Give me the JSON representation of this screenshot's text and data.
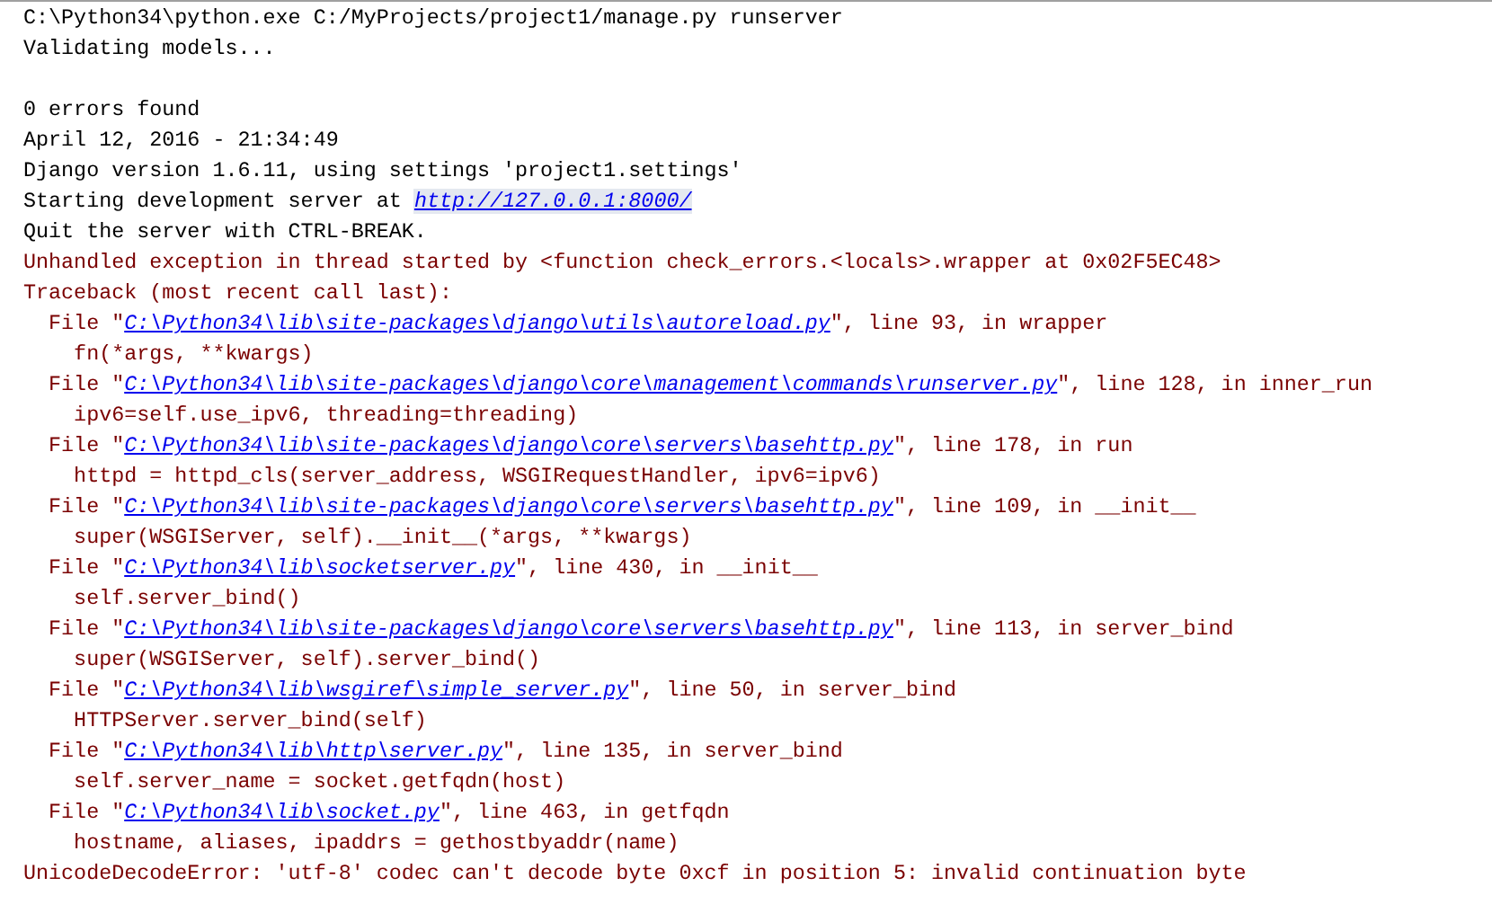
{
  "console": {
    "lines": [
      {
        "kind": "stdout",
        "parts": [
          {
            "text": "C:\\Python34\\python.exe C:/MyProjects/project1/manage.py runserver"
          }
        ]
      },
      {
        "kind": "stdout",
        "parts": [
          {
            "text": "Validating models..."
          }
        ]
      },
      {
        "kind": "blank"
      },
      {
        "kind": "stdout",
        "parts": [
          {
            "text": "0 errors found"
          }
        ]
      },
      {
        "kind": "stdout",
        "parts": [
          {
            "text": "April 12, 2016 - 21:34:49"
          }
        ]
      },
      {
        "kind": "stdout",
        "parts": [
          {
            "text": "Django version 1.6.11, using settings 'project1.settings'"
          }
        ]
      },
      {
        "kind": "stdout",
        "parts": [
          {
            "text": "Starting development server at "
          },
          {
            "text": "http://127.0.0.1:8000/",
            "link": true,
            "highlighted": true
          }
        ]
      },
      {
        "kind": "stdout",
        "parts": [
          {
            "text": "Quit the server with CTRL-BREAK."
          }
        ]
      },
      {
        "kind": "stderr",
        "parts": [
          {
            "text": "Unhandled exception in thread started by <function check_errors.<locals>.wrapper at 0x02F5EC48>"
          }
        ]
      },
      {
        "kind": "stderr",
        "parts": [
          {
            "text": "Traceback (most recent call last):"
          }
        ]
      },
      {
        "kind": "stderr",
        "parts": [
          {
            "text": "  File \""
          },
          {
            "text": "C:\\Python34\\lib\\site-packages\\django\\utils\\autoreload.py",
            "link": true,
            "highlighted": false
          },
          {
            "text": "\", line 93, in wrapper"
          }
        ]
      },
      {
        "kind": "stderr",
        "parts": [
          {
            "text": "    fn(*args, **kwargs)"
          }
        ]
      },
      {
        "kind": "stderr",
        "parts": [
          {
            "text": "  File \""
          },
          {
            "text": "C:\\Python34\\lib\\site-packages\\django\\core\\management\\commands\\runserver.py",
            "link": true,
            "highlighted": false
          },
          {
            "text": "\", line 128, in inner_run"
          }
        ]
      },
      {
        "kind": "stderr",
        "parts": [
          {
            "text": "    ipv6=self.use_ipv6, threading=threading)"
          }
        ]
      },
      {
        "kind": "stderr",
        "parts": [
          {
            "text": "  File \""
          },
          {
            "text": "C:\\Python34\\lib\\site-packages\\django\\core\\servers\\basehttp.py",
            "link": true,
            "highlighted": false
          },
          {
            "text": "\", line 178, in run"
          }
        ]
      },
      {
        "kind": "stderr",
        "parts": [
          {
            "text": "    httpd = httpd_cls(server_address, WSGIRequestHandler, ipv6=ipv6)"
          }
        ]
      },
      {
        "kind": "stderr",
        "parts": [
          {
            "text": "  File \""
          },
          {
            "text": "C:\\Python34\\lib\\site-packages\\django\\core\\servers\\basehttp.py",
            "link": true,
            "highlighted": false
          },
          {
            "text": "\", line 109, in __init__"
          }
        ]
      },
      {
        "kind": "stderr",
        "parts": [
          {
            "text": "    super(WSGIServer, self).__init__(*args, **kwargs)"
          }
        ]
      },
      {
        "kind": "stderr",
        "parts": [
          {
            "text": "  File \""
          },
          {
            "text": "C:\\Python34\\lib\\socketserver.py",
            "link": true,
            "highlighted": false
          },
          {
            "text": "\", line 430, in __init__"
          }
        ]
      },
      {
        "kind": "stderr",
        "parts": [
          {
            "text": "    self.server_bind()"
          }
        ]
      },
      {
        "kind": "stderr",
        "parts": [
          {
            "text": "  File \""
          },
          {
            "text": "C:\\Python34\\lib\\site-packages\\django\\core\\servers\\basehttp.py",
            "link": true,
            "highlighted": false
          },
          {
            "text": "\", line 113, in server_bind"
          }
        ]
      },
      {
        "kind": "stderr",
        "parts": [
          {
            "text": "    super(WSGIServer, self).server_bind()"
          }
        ]
      },
      {
        "kind": "stderr",
        "parts": [
          {
            "text": "  File \""
          },
          {
            "text": "C:\\Python34\\lib\\wsgiref\\simple_server.py",
            "link": true,
            "highlighted": false
          },
          {
            "text": "\", line 50, in server_bind"
          }
        ]
      },
      {
        "kind": "stderr",
        "parts": [
          {
            "text": "    HTTPServer.server_bind(self)"
          }
        ]
      },
      {
        "kind": "stderr",
        "parts": [
          {
            "text": "  File \""
          },
          {
            "text": "C:\\Python34\\lib\\http\\server.py",
            "link": true,
            "highlighted": false
          },
          {
            "text": "\", line 135, in server_bind"
          }
        ]
      },
      {
        "kind": "stderr",
        "parts": [
          {
            "text": "    self.server_name = socket.getfqdn(host)"
          }
        ]
      },
      {
        "kind": "stderr",
        "parts": [
          {
            "text": "  File \""
          },
          {
            "text": "C:\\Python34\\lib\\socket.py",
            "link": true,
            "highlighted": false
          },
          {
            "text": "\", line 463, in getfqdn"
          }
        ]
      },
      {
        "kind": "stderr",
        "parts": [
          {
            "text": "    hostname, aliases, ipaddrs = gethostbyaddr(name)"
          }
        ]
      },
      {
        "kind": "stderr",
        "parts": [
          {
            "text": "UnicodeDecodeError: 'utf-8' codec can't decode byte 0xcf in position 5: invalid continuation byte"
          }
        ]
      }
    ]
  }
}
